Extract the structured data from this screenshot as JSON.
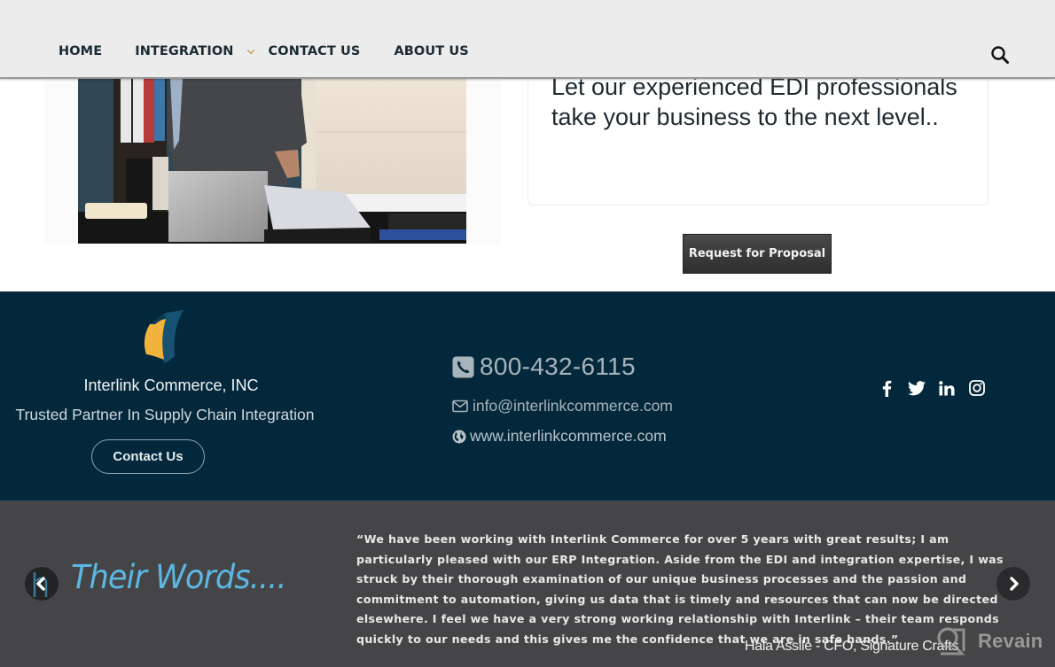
{
  "nav": {
    "items": [
      {
        "label": "HOME"
      },
      {
        "label": "INTEGRATION",
        "has_dropdown": true
      },
      {
        "label": "CONTACT US"
      },
      {
        "label": "ABOUT US"
      }
    ],
    "search_icon": "search-icon",
    "dropdown_color": "#c9a25a"
  },
  "hero": {
    "image_alt": "Businessman working at laptop in office",
    "text": "Let our experienced EDI professionals take your business to the next level..",
    "cta_label": "Request for Proposal"
  },
  "footer": {
    "company_name": "Interlink Commerce, INC",
    "tagline": "Trusted Partner In Supply Chain Integration",
    "contact_button": "Contact Us",
    "phone": "800-432-6115",
    "email": "info@interlinkcommerce.com",
    "website": "www.interlinkcommerce.com",
    "social": [
      "facebook-icon",
      "twitter-icon",
      "linkedin-icon",
      "instagram-icon"
    ],
    "background_color": "#04283b"
  },
  "testimonial": {
    "heading": "Their Words....",
    "quote": "“We have been working with Interlink Commerce for over 5 years with great results; I am particularly pleased with our ERP Integration. Aside from the EDI and integration expertise, I was struck by their thorough examination of our unique business processes and the passion and commitment to automation, giving us data that is timely and resources that can now be directed elsewhere. I feel we have a very strong working relationship with Interlink – their team responds quickly to our needs and this gives me the confidence that we are in safe hands.”",
    "author": "Hala Assile - CFO, Signature Crafts",
    "heading_color": "#5bb8e3",
    "background_color": "#454446"
  },
  "watermark": {
    "label": "Revain"
  }
}
